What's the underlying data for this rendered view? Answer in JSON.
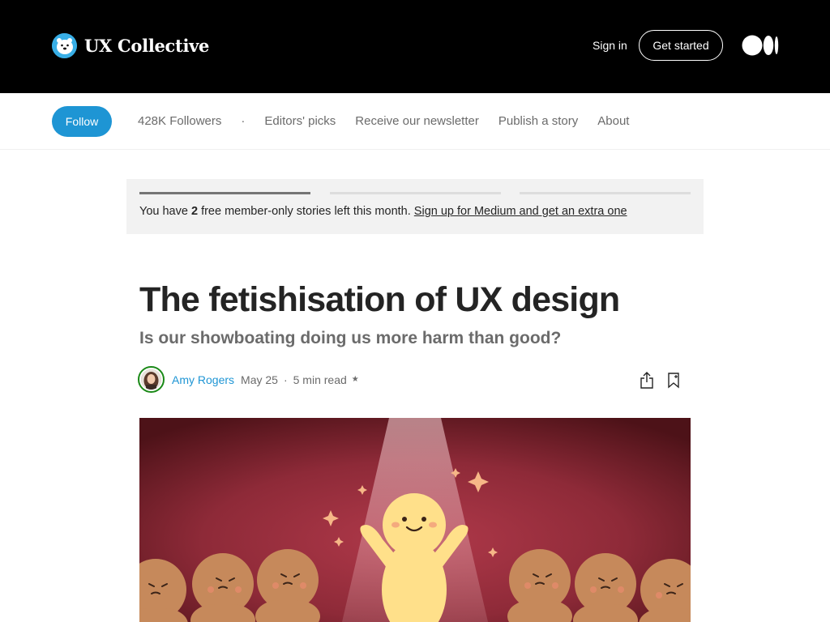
{
  "header": {
    "brand_name": "UX Collective",
    "sign_in": "Sign in",
    "get_started": "Get started",
    "logo_icon": "polar-bear-icon",
    "medium_icon": "medium-logo-icon"
  },
  "pubnav": {
    "follow": "Follow",
    "followers": "428K Followers",
    "separator": "·",
    "links": [
      "Editors' picks",
      "Receive our newsletter",
      "Publish a story",
      "About"
    ]
  },
  "banner": {
    "prefix": "You have ",
    "count": "2",
    "middle": " free member-only stories left this month. ",
    "link": "Sign up for Medium and get an extra one",
    "stories_used_fraction": 0.333
  },
  "article": {
    "title": "The fetishisation of UX design",
    "subtitle": "Is our showboating doing us more harm than good?",
    "author": "Amy Rogers",
    "date": "May 25",
    "dot": "·",
    "read_time": "5 min read",
    "star": "★",
    "share_icon": "share-icon",
    "bookmark_icon": "bookmark-icon"
  },
  "colors": {
    "header_bg": "#000000",
    "follow_bg": "#1e95d4",
    "author_link": "#1e95d4",
    "hero_bg": "#8a2a35",
    "character_highlight": "#ffe28a",
    "character_crowd": "#c98b5c"
  }
}
